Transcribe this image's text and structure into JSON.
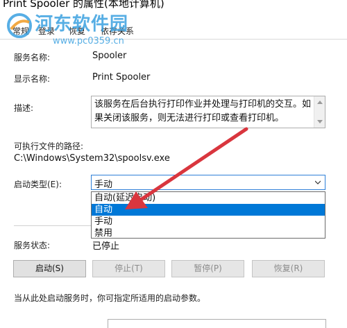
{
  "window": {
    "title": "Print Spooler 的属性(本地计算机)"
  },
  "watermark": {
    "name": "河东软件园",
    "url": "www.pc0359.cn"
  },
  "tabs": [
    {
      "label": "常规",
      "active": true
    },
    {
      "label": "登录",
      "active": false
    },
    {
      "label": "恢复",
      "active": false
    },
    {
      "label": "依存关系",
      "active": false
    }
  ],
  "fields": {
    "service_name_label": "服务名称:",
    "service_name_value": "Spooler",
    "display_name_label": "显示名称:",
    "display_name_value": "Print Spooler",
    "description_label": "描述:",
    "description_value": "该服务在后台执行打印作业并处理与打印机的交互。如果关闭该服务，则无法进行打印或查看打印机。",
    "exe_path_label": "可执行文件的路径:",
    "exe_path_value": "C:\\Windows\\System32\\spoolsv.exe",
    "startup_type_label": "启动类型(E):",
    "startup_type_value": "手动"
  },
  "startup_options": [
    {
      "label": "自动(延迟启动)",
      "selected": false
    },
    {
      "label": "自动",
      "selected": true
    },
    {
      "label": "手动",
      "selected": false
    },
    {
      "label": "禁用",
      "selected": false
    }
  ],
  "status": {
    "label": "服务状态:",
    "value": "已停止"
  },
  "buttons": {
    "start": "启动(S)",
    "stop": "停止(T)",
    "pause": "暂停(P)",
    "resume": "恢复(R)"
  },
  "hint": "当从此处启动服务时，你可指定所适用的启动参数。",
  "colors": {
    "accent": "#0078d7",
    "arrow": "#d9363e",
    "watermark": "#3aa0e0"
  }
}
